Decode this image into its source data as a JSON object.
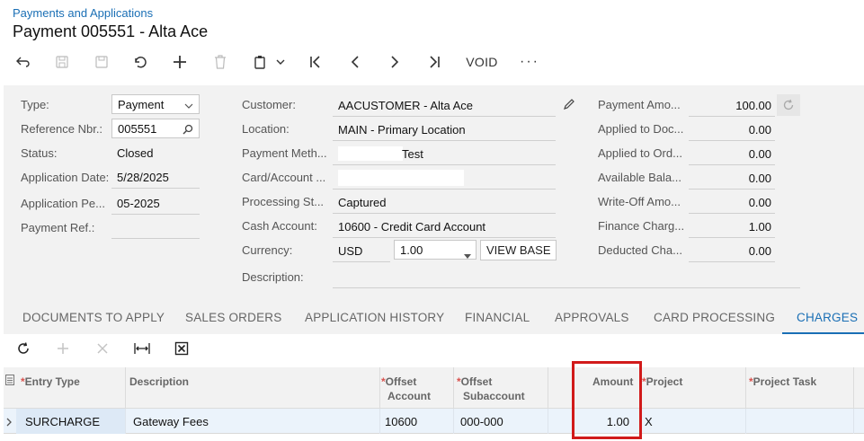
{
  "breadcrumb": "Payments and Applications",
  "title": "Payment 005551 - Alta Ace",
  "toolbar": {
    "void_label": "VOID",
    "more_label": "···"
  },
  "form": {
    "type": {
      "label": "Type:",
      "value": "Payment"
    },
    "reference": {
      "label": "Reference Nbr.:",
      "value": "005551"
    },
    "status": {
      "label": "Status:",
      "value": "Closed"
    },
    "app_date": {
      "label": "Application Date:",
      "value": "5/28/2025"
    },
    "app_period": {
      "label": "Application Pe...",
      "value": "05-2025"
    },
    "payment_ref": {
      "label": "Payment Ref.:",
      "value": ""
    },
    "customer": {
      "label": "Customer:",
      "value": "AACUSTOMER - Alta Ace"
    },
    "location": {
      "label": "Location:",
      "value": "MAIN - Primary Location"
    },
    "payment_method": {
      "label": "Payment Meth...",
      "value": "Test"
    },
    "card_account": {
      "label": "Card/Account ...",
      "value": ""
    },
    "processing_status": {
      "label": "Processing St...",
      "value": "Captured"
    },
    "cash_account": {
      "label": "Cash Account:",
      "value": "10600 - Credit Card Account"
    },
    "currency": {
      "label": "Currency:",
      "code": "USD",
      "rate": "1.00",
      "view_base": "VIEW BASE"
    },
    "description": {
      "label": "Description:",
      "value": ""
    },
    "payment_amount": {
      "label": "Payment Amo...",
      "value": "100.00"
    },
    "applied_docs": {
      "label": "Applied to Doc...",
      "value": "0.00"
    },
    "applied_orders": {
      "label": "Applied to Ord...",
      "value": "0.00"
    },
    "available_balance": {
      "label": "Available Bala...",
      "value": "0.00"
    },
    "write_off": {
      "label": "Write-Off Amo...",
      "value": "0.00"
    },
    "finance_charges": {
      "label": "Finance Charg...",
      "value": "1.00"
    },
    "deducted_charges": {
      "label": "Deducted Cha...",
      "value": "0.00"
    }
  },
  "tabs": [
    {
      "label": "DOCUMENTS TO APPLY"
    },
    {
      "label": "SALES ORDERS"
    },
    {
      "label": "APPLICATION HISTORY"
    },
    {
      "label": "FINANCIAL"
    },
    {
      "label": "APPROVALS"
    },
    {
      "label": "CARD PROCESSING"
    },
    {
      "label": "CHARGES"
    }
  ],
  "active_tab": "CHARGES",
  "grid": {
    "columns": {
      "entry_type": "Entry Type",
      "description": "Description",
      "offset_account_1": "Offset",
      "offset_account_2": "Account",
      "offset_subaccount_1": "Offset",
      "offset_subaccount_2": "Subaccount",
      "amount": "Amount",
      "project": "Project",
      "project_task": "Project Task",
      "required_mark": "*"
    },
    "rows": [
      {
        "entry_type": "SURCHARGE",
        "description": "Gateway Fees",
        "offset_account": "10600",
        "offset_subaccount": "000-000",
        "amount": "1.00",
        "project": "X",
        "project_task": ""
      }
    ]
  },
  "colors": {
    "accent": "#1a6fb5",
    "highlight": "#d11a1a",
    "panel": "#f2f2f2"
  }
}
